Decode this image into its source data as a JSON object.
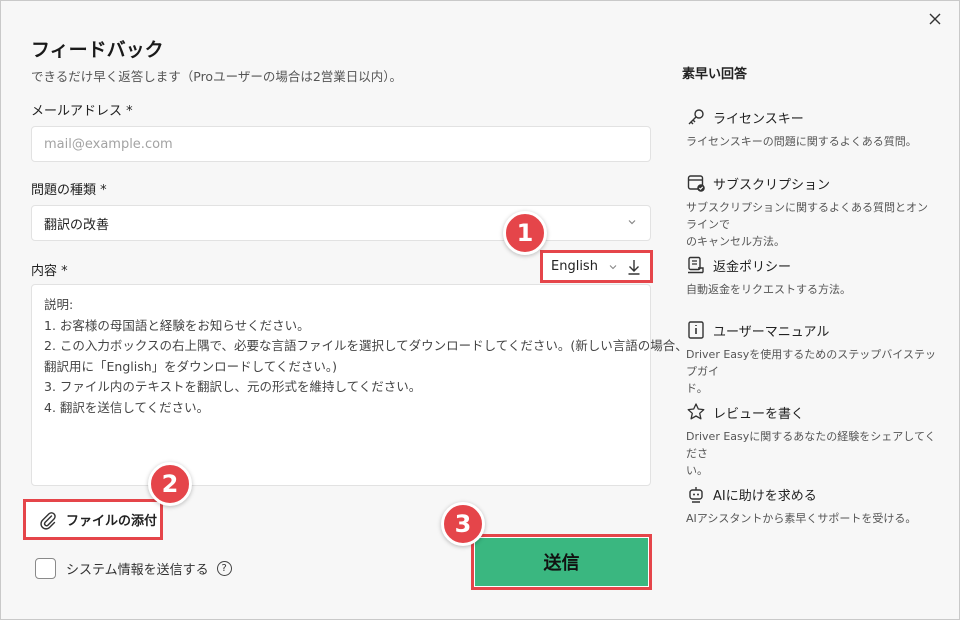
{
  "dialog": {
    "title": "フィードバック",
    "subtitle": "できるだけ早く返答します（Proユーザーの場合は2営業日以内）。",
    "close_icon": "close-icon"
  },
  "form": {
    "email_label": "メールアドレス *",
    "email_placeholder": "mail@example.com",
    "issue_label": "問題の種類 *",
    "issue_value": "翻訳の改善",
    "content_label": "内容 *",
    "language_value": "English",
    "content_lines": [
      "説明:",
      "1. お客様の母国語と経験をお知らせください。",
      "2. この入力ボックスの右上隅で、必要な言語ファイルを選択してダウンロードしてください。(新しい言語の場合、",
      "翻訳用に「English」をダウンロードしてください。)",
      "3. ファイル内のテキストを翻訳し、元の形式を維持してください。",
      "4. 翻訳を送信してください。"
    ],
    "attach_label": "ファイルの添付",
    "sysinfo_label": "システム情報を送信する",
    "help_glyph": "?",
    "send_label": "送信"
  },
  "badges": [
    "1",
    "2",
    "3"
  ],
  "quick": {
    "title": "素早い回答",
    "items": [
      {
        "icon": "key-icon",
        "label": "ライセンスキー",
        "desc": [
          "ライセンスキーの問題に関するよくある質問。"
        ]
      },
      {
        "icon": "subscription-icon",
        "label": "サブスクリプション",
        "desc": [
          "サブスクリプションに関するよくある質問とオンラインで",
          "のキャンセル方法。"
        ]
      },
      {
        "icon": "refund-icon",
        "label": "返金ポリシー",
        "desc": [
          "自動返金をリクエストする方法。"
        ]
      },
      {
        "icon": "manual-icon",
        "label": "ユーザーマニュアル",
        "desc": [
          "Driver Easyを使用するためのステップバイステップガイ",
          "ド。"
        ]
      },
      {
        "icon": "star-icon",
        "label": "レビューを書く",
        "desc": [
          "Driver Easyに関するあなたの経験をシェアしてくださ",
          "い。"
        ]
      },
      {
        "icon": "ai-assistant-icon",
        "label": "AIに助けを求める",
        "desc": [
          "AIアシスタントから素早くサポートを受ける。"
        ]
      }
    ]
  },
  "colors": {
    "accent": "#3ab780",
    "highlight": "#e5454a"
  }
}
